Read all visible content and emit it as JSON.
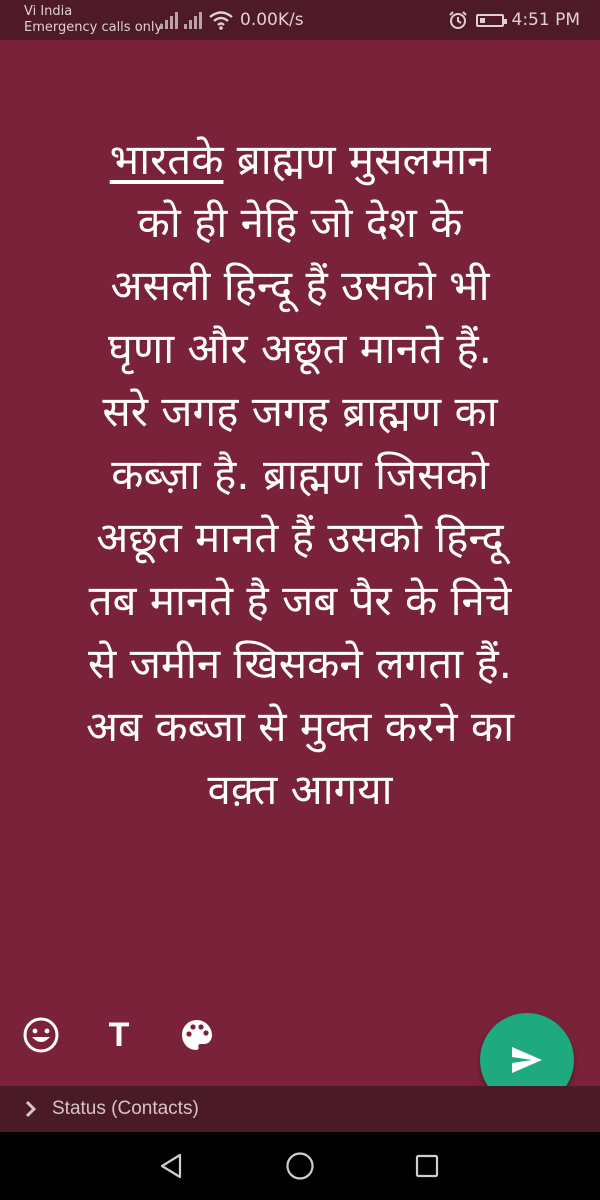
{
  "status_bar": {
    "carrier": "Vi India",
    "network_note": "Emergency calls only",
    "speed": "0.00K/s",
    "time": "4:51 PM",
    "icons": [
      "signal-icon",
      "signal-icon",
      "wifi-icon",
      "alarm-icon",
      "battery-icon"
    ]
  },
  "status_post": {
    "background_color": "#7a2239",
    "lines": [
      "भारतके ब्राह्मण मुसलमान",
      "को ही नेहि जो देश के",
      "असली हिन्दू हैं उसको भी",
      "घृणा और अछूत मानते हैं.",
      "सरे जगह जगह ब्राह्मण का",
      "कब्ज़ा है. ब्राह्मण जिसको",
      "अछूत मानते हैं उसको हिन्दू",
      "तब मानते है जब पैर के निचे",
      "से जमीन खिसकने लगता हैं.",
      "अब कब्जा से मुक्त करने का",
      "वक़्त आगया"
    ],
    "underlined_lead": "भारतके",
    "lead_rest": " ब्राह्मण मुसलमान"
  },
  "toolbar": {
    "emoji_icon": "emoji-icon",
    "text_label": "T",
    "palette_icon": "palette-icon"
  },
  "send_button": {
    "icon": "send-icon",
    "color": "#1fa97f"
  },
  "audience": {
    "label": "Status (Contacts)",
    "icon": "chevron-right-icon"
  },
  "nav_bar": {
    "icons": [
      "back-icon",
      "home-icon",
      "recents-icon"
    ]
  }
}
